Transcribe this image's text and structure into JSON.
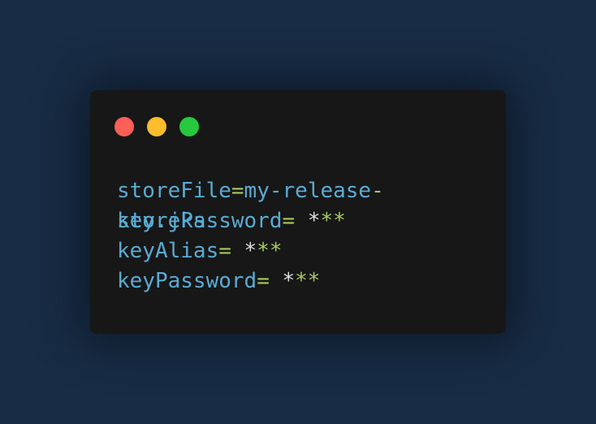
{
  "colors": {
    "background": "#172c45",
    "card": "#171718",
    "key": "#5aabd3",
    "operator": "#a9c85e",
    "mask_first": "#dedede",
    "dot_red": "#ff5f56",
    "dot_yellow": "#ffbd2e",
    "dot_green": "#27c93f"
  },
  "window": {
    "controls": [
      "close",
      "minimize",
      "maximize"
    ]
  },
  "code": {
    "line1": {
      "key": "storeFile",
      "eq": "=",
      "value_part1": "my-release",
      "value_part1_dash": "-",
      "value_part2": "key.jks"
    },
    "line2": {
      "key": "storePassword",
      "eq": "=",
      "space": " ",
      "mask_first": "*",
      "mask_rest": "**"
    },
    "line3": {
      "key": "keyAlias",
      "eq": "=",
      "space": " ",
      "mask_first": "*",
      "mask_rest": "**"
    },
    "line4": {
      "key": "keyPassword",
      "eq": "=",
      "space": " ",
      "mask_first": "*",
      "mask_rest": "**"
    }
  }
}
